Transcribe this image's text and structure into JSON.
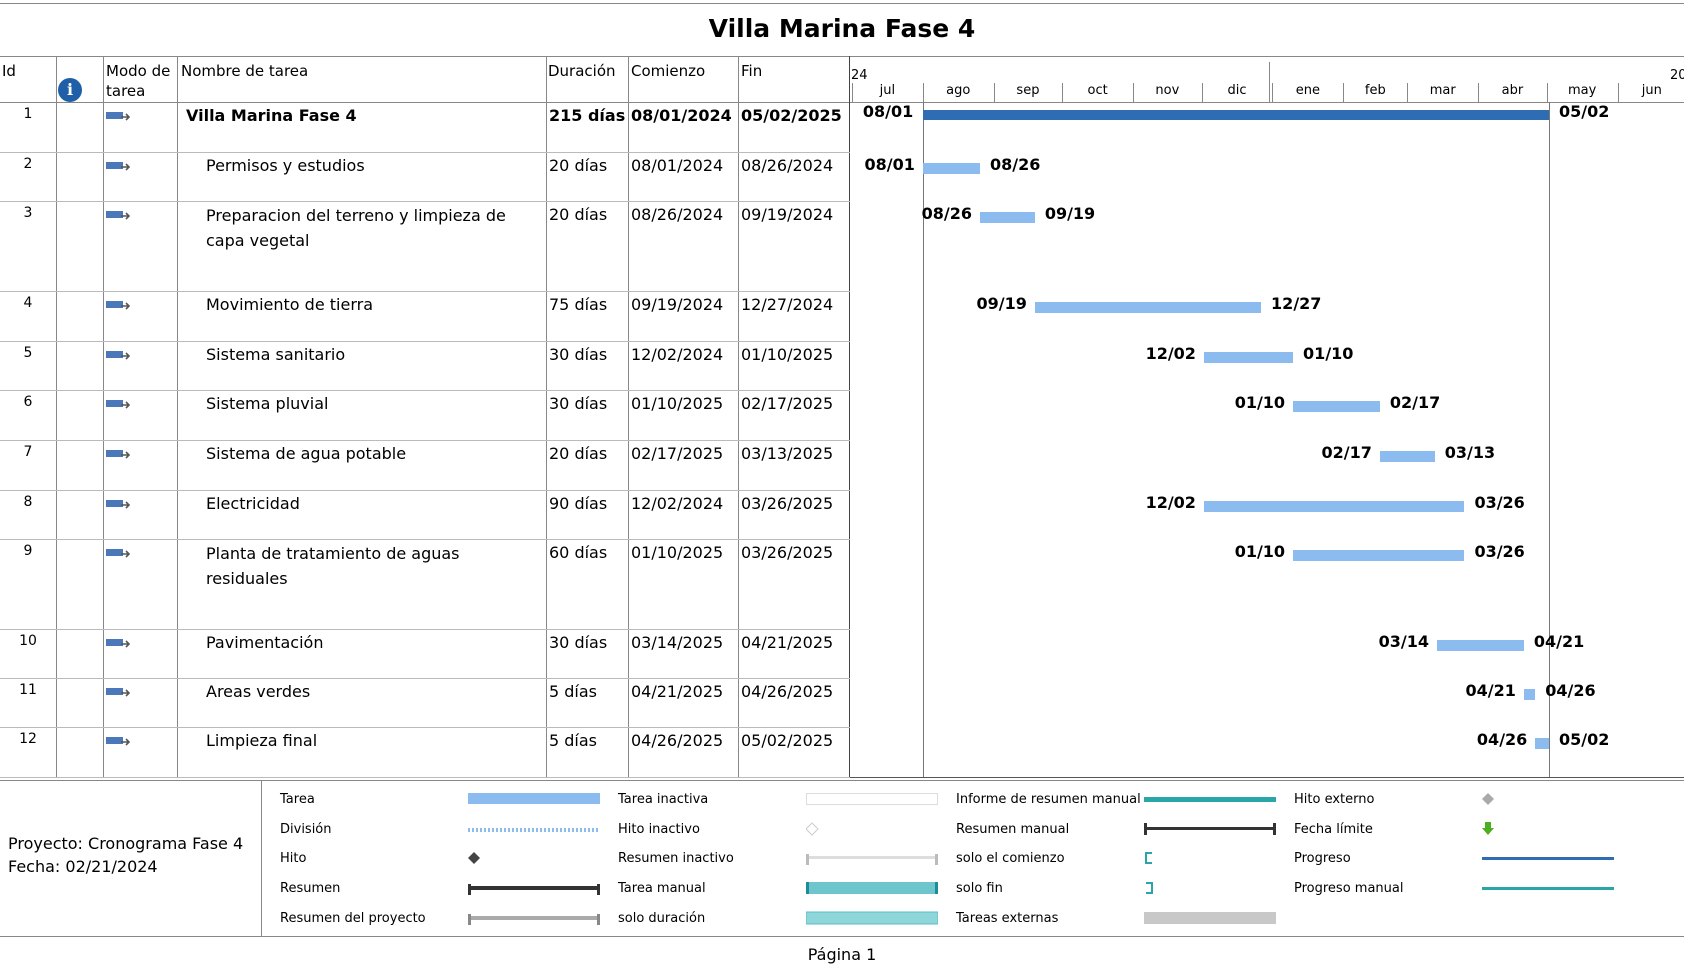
{
  "title": "Villa Marina Fase 4",
  "columns": {
    "id": "Id",
    "mode": "Modo de tarea",
    "name": "Nombre de tarea",
    "duration": "Duración",
    "start": "Comienzo",
    "finish": "Fin"
  },
  "timeline": {
    "year_left": "24",
    "year_right": "20",
    "months": [
      "jul",
      "ago",
      "sep",
      "oct",
      "nov",
      "dic",
      "ene",
      "feb",
      "mar",
      "abr",
      "may",
      "jun"
    ]
  },
  "tasks": [
    {
      "id": "1",
      "name": "Villa Marina Fase 4",
      "duration": "215 días",
      "start": "08/01/2024",
      "finish": "05/02/2025",
      "start_label": "08/01",
      "finish_label": "05/02",
      "summary": true
    },
    {
      "id": "2",
      "name": "Permisos y estudios",
      "duration": "20 días",
      "start": "08/01/2024",
      "finish": "08/26/2024",
      "start_label": "08/01",
      "finish_label": "08/26"
    },
    {
      "id": "3",
      "name": "Preparacion del terreno y limpieza de capa vegetal",
      "duration": "20 días",
      "start": "08/26/2024",
      "finish": "09/19/2024",
      "start_label": "08/26",
      "finish_label": "09/19"
    },
    {
      "id": "4",
      "name": "Movimiento de tierra",
      "duration": "75 días",
      "start": "09/19/2024",
      "finish": "12/27/2024",
      "start_label": "09/19",
      "finish_label": "12/27"
    },
    {
      "id": "5",
      "name": "Sistema sanitario",
      "duration": "30 días",
      "start": "12/02/2024",
      "finish": "01/10/2025",
      "start_label": "12/02",
      "finish_label": "01/10"
    },
    {
      "id": "6",
      "name": "Sistema pluvial",
      "duration": "30 días",
      "start": "01/10/2025",
      "finish": "02/17/2025",
      "start_label": "01/10",
      "finish_label": "02/17"
    },
    {
      "id": "7",
      "name": "Sistema de agua potable",
      "duration": "20 días",
      "start": "02/17/2025",
      "finish": "03/13/2025",
      "start_label": "02/17",
      "finish_label": "03/13"
    },
    {
      "id": "8",
      "name": "Electricidad",
      "duration": "90 días",
      "start": "12/02/2024",
      "finish": "03/26/2025",
      "start_label": "12/02",
      "finish_label": "03/26"
    },
    {
      "id": "9",
      "name": "Planta de tratamiento de aguas residuales",
      "duration": "60 días",
      "start": "01/10/2025",
      "finish": "03/26/2025",
      "start_label": "01/10",
      "finish_label": "03/26"
    },
    {
      "id": "10",
      "name": "Pavimentación",
      "duration": "30 días",
      "start": "03/14/2025",
      "finish": "04/21/2025",
      "start_label": "03/14",
      "finish_label": "04/21"
    },
    {
      "id": "11",
      "name": "Areas verdes",
      "duration": "5 días",
      "start": "04/21/2025",
      "finish": "04/26/2025",
      "start_label": "04/21",
      "finish_label": "04/26"
    },
    {
      "id": "12",
      "name": "Limpieza final",
      "duration": "5 días",
      "start": "04/26/2025",
      "finish": "05/02/2025",
      "start_label": "04/26",
      "finish_label": "05/02"
    }
  ],
  "chart_data": {
    "type": "gantt",
    "title": "Villa Marina Fase 4",
    "x_range": [
      "2024-07-01",
      "2025-06-30"
    ],
    "tasks": [
      {
        "id": 1,
        "name": "Villa Marina Fase 4",
        "start": "2024-08-01",
        "end": "2025-05-02",
        "summary": true
      },
      {
        "id": 2,
        "name": "Permisos y estudios",
        "start": "2024-08-01",
        "end": "2024-08-26"
      },
      {
        "id": 3,
        "name": "Preparacion del terreno y limpieza de capa vegetal",
        "start": "2024-08-26",
        "end": "2024-09-19"
      },
      {
        "id": 4,
        "name": "Movimiento de tierra",
        "start": "2024-09-19",
        "end": "2024-12-27"
      },
      {
        "id": 5,
        "name": "Sistema sanitario",
        "start": "2024-12-02",
        "end": "2025-01-10"
      },
      {
        "id": 6,
        "name": "Sistema pluvial",
        "start": "2025-01-10",
        "end": "2025-02-17"
      },
      {
        "id": 7,
        "name": "Sistema de agua potable",
        "start": "2025-02-17",
        "end": "2025-03-13"
      },
      {
        "id": 8,
        "name": "Electricidad",
        "start": "2024-12-02",
        "end": "2025-03-26"
      },
      {
        "id": 9,
        "name": "Planta de tratamiento de aguas residuales",
        "start": "2025-01-10",
        "end": "2025-03-26"
      },
      {
        "id": 10,
        "name": "Pavimentación",
        "start": "2025-03-14",
        "end": "2025-04-21"
      },
      {
        "id": 11,
        "name": "Areas verdes",
        "start": "2025-04-21",
        "end": "2025-04-26"
      },
      {
        "id": 12,
        "name": "Limpieza final",
        "start": "2025-04-26",
        "end": "2025-05-02"
      }
    ]
  },
  "legend": {
    "project": "Proyecto: Cronograma Fase 4",
    "date": "Fecha: 02/21/2024",
    "items": [
      "Tarea",
      "División",
      "Hito",
      "Resumen",
      "Resumen del proyecto",
      "Tarea inactiva",
      "Hito inactivo",
      "Resumen inactivo",
      "Tarea manual",
      "solo duración",
      "Informe de resumen manual",
      "Resumen manual",
      "solo el comienzo",
      "solo fin",
      "Tareas externas",
      "Hito externo",
      "Fecha límite",
      "Progreso",
      "Progreso manual"
    ]
  },
  "footer": "Página 1",
  "colors": {
    "task": "#8cbcef",
    "summary": "#2e6db4",
    "manual": "#2aa5a8"
  }
}
